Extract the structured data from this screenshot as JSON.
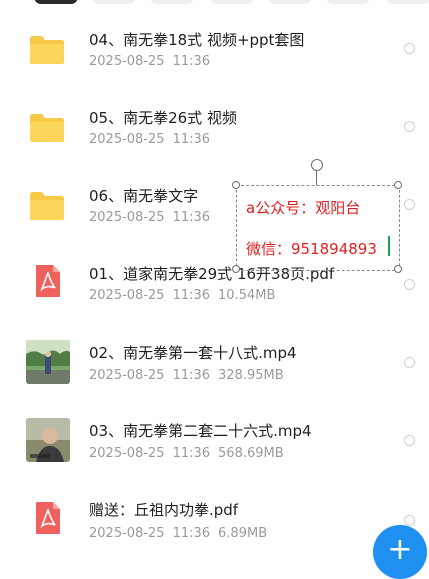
{
  "files": [
    {
      "type": "folder",
      "name": "04、南无拳18式 视频+ppt套图",
      "date": "2025-08-25",
      "time": "11:36",
      "size": ""
    },
    {
      "type": "folder",
      "name": "05、南无拳26式 视频",
      "date": "2025-08-25",
      "time": "11:36",
      "size": ""
    },
    {
      "type": "folder",
      "name": "06、南无拳文字",
      "date": "2025-08-25",
      "time": "11:36",
      "size": ""
    },
    {
      "type": "pdf",
      "name": "01、道家南无拳29式 16开38页.pdf",
      "date": "2025-08-25",
      "time": "11:36",
      "size": "10.54MB"
    },
    {
      "type": "video",
      "name": "02、南无拳第一套十八式.mp4",
      "date": "2025-08-25",
      "time": "11:36",
      "size": "328.95MB"
    },
    {
      "type": "video",
      "name": "03、南无拳第二套二十六式.mp4",
      "date": "2025-08-25",
      "time": "11:36",
      "size": "568.69MB"
    },
    {
      "type": "pdf",
      "name": "赠送：丘祖内功拳.pdf",
      "date": "2025-08-25",
      "time": "11:36",
      "size": "6.89MB"
    }
  ],
  "text_box": {
    "line1": "a公众号：观阳台",
    "line2": "微信：951894893",
    "color": "#e02020"
  },
  "icons": {
    "folder": "folder-icon",
    "pdf": "pdf-icon",
    "video": "video-thumbnail",
    "fab": "plus-icon"
  },
  "fab_label": "+",
  "colors": {
    "accent": "#1f8ff0",
    "folder": "#f7c948",
    "pdf": "#f0615d"
  }
}
